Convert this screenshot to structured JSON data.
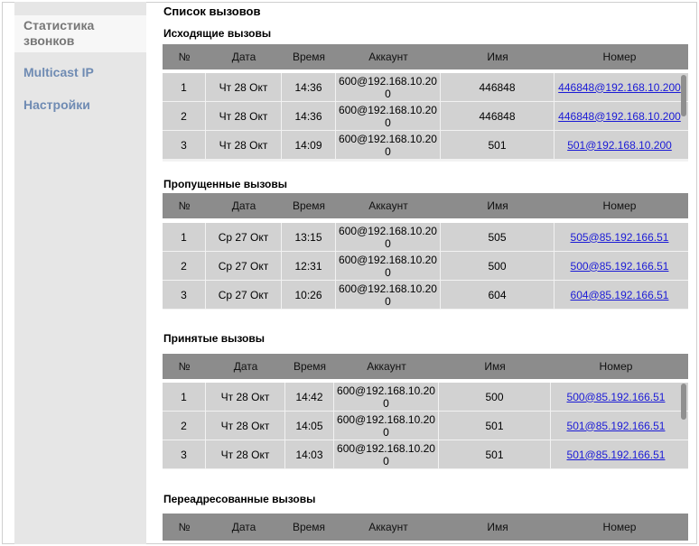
{
  "sidebar": {
    "items": [
      {
        "label": "Статистика звонков",
        "active": true
      },
      {
        "label": "Multicast IP",
        "active": false
      },
      {
        "label": "Настройки",
        "active": false
      }
    ]
  },
  "page": {
    "title": "Список вызовов"
  },
  "columns": [
    "№",
    "Дата",
    "Время",
    "Аккаунт",
    "Имя",
    "Номер"
  ],
  "outgoing": {
    "title": "Исходящие вызовы",
    "rows": [
      {
        "n": "1",
        "date": "Чт 28 Окт",
        "time": "14:36",
        "account": "600@192.168.10.200",
        "name": "446848",
        "number": "446848@192.168.10.200"
      },
      {
        "n": "2",
        "date": "Чт 28 Окт",
        "time": "14:36",
        "account": "600@192.168.10.200",
        "name": "446848",
        "number": "446848@192.168.10.200"
      },
      {
        "n": "3",
        "date": "Чт 28 Окт",
        "time": "14:09",
        "account": "600@192.168.10.200",
        "name": "501",
        "number": "501@192.168.10.200"
      }
    ]
  },
  "missed": {
    "title": "Пропущенные вызовы",
    "rows": [
      {
        "n": "1",
        "date": "Ср 27 Окт",
        "time": "13:15",
        "account": "600@192.168.10.200",
        "name": "505",
        "number": "505@85.192.166.51"
      },
      {
        "n": "2",
        "date": "Ср 27 Окт",
        "time": "12:31",
        "account": "600@192.168.10.200",
        "name": "500",
        "number": "500@85.192.166.51"
      },
      {
        "n": "3",
        "date": "Ср 27 Окт",
        "time": "10:26",
        "account": "600@192.168.10.200",
        "name": "604",
        "number": "604@85.192.166.51"
      }
    ]
  },
  "received": {
    "title": "Принятые вызовы",
    "rows": [
      {
        "n": "1",
        "date": "Чт 28 Окт",
        "time": "14:42",
        "account": "600@192.168.10.200",
        "name": "500",
        "number": "500@85.192.166.51"
      },
      {
        "n": "2",
        "date": "Чт 28 Окт",
        "time": "14:05",
        "account": "600@192.168.10.200",
        "name": "501",
        "number": "501@85.192.166.51"
      },
      {
        "n": "3",
        "date": "Чт 28 Окт",
        "time": "14:03",
        "account": "600@192.168.10.200",
        "name": "501",
        "number": "501@85.192.166.51"
      }
    ]
  },
  "forwarded": {
    "title": "Переадресованные вызовы"
  }
}
